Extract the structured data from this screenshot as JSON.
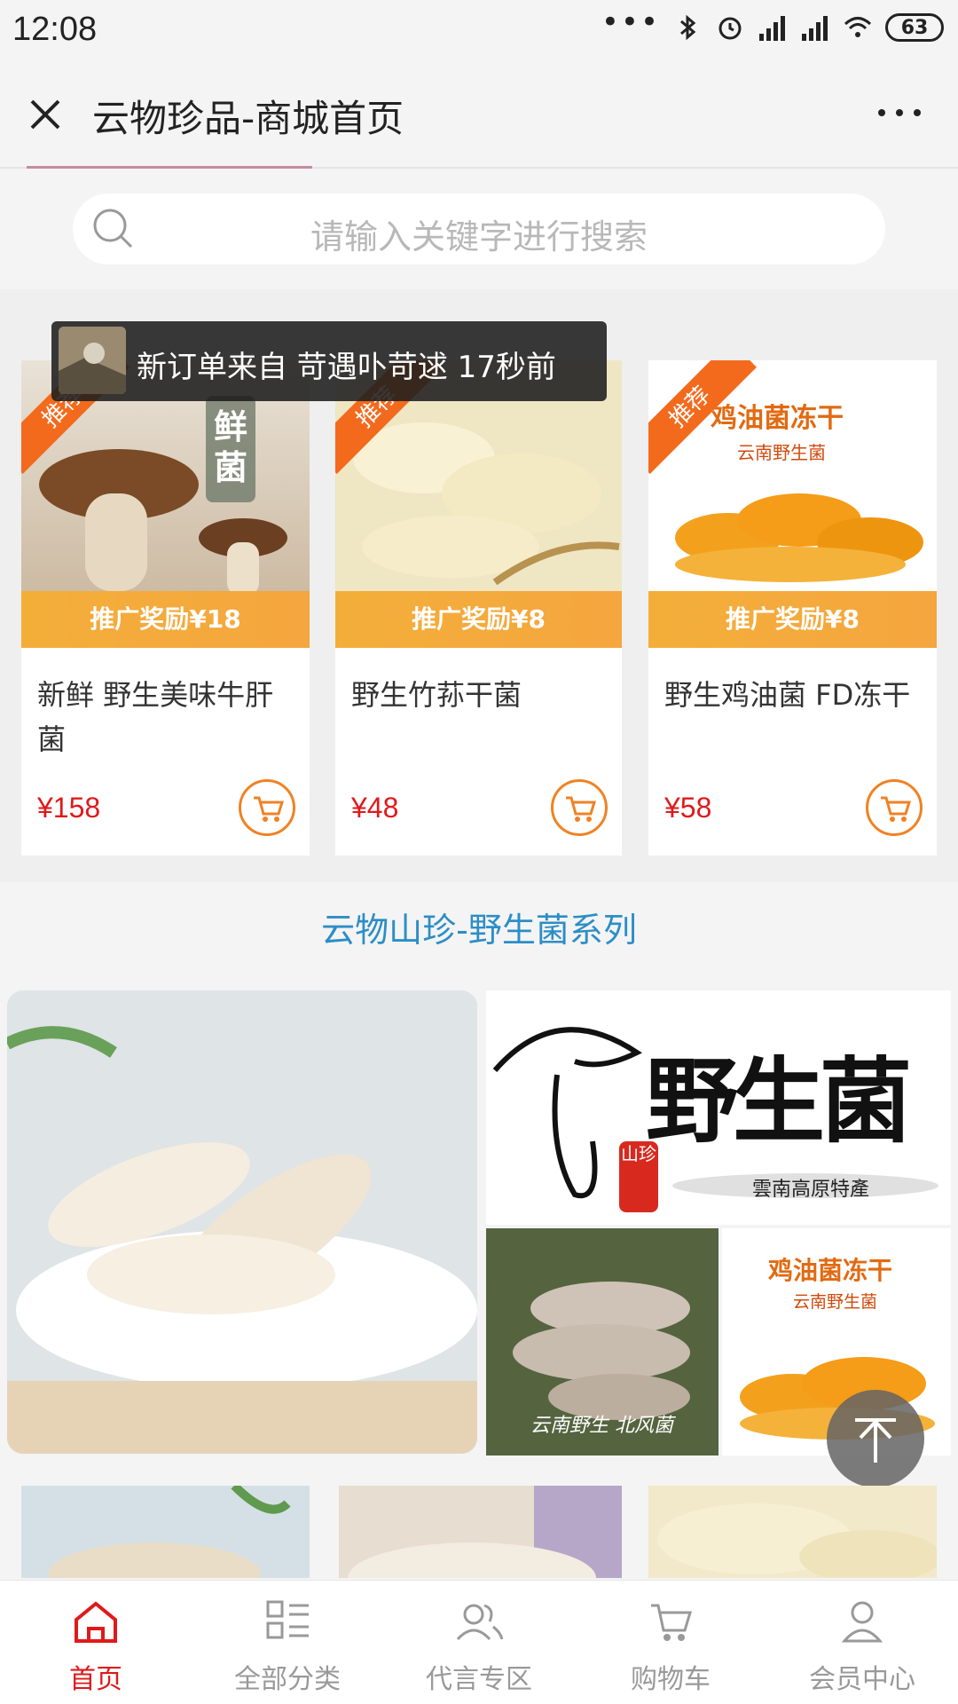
{
  "status_bar": {
    "time": "12:08",
    "battery": "63"
  },
  "titlebar": {
    "title": "云物珍品-商城首页"
  },
  "search": {
    "placeholder": "请输入关键字进行搜索"
  },
  "toast": {
    "text": "新订单来自 苛遇卟苛逑 17秒前"
  },
  "products": [
    {
      "ribbon": "推荐",
      "reward": "推广奖励¥18",
      "name": "新鲜 野生美味牛肝菌",
      "price": "¥158",
      "img_text": "鲜菌"
    },
    {
      "ribbon": "推荐",
      "reward": "推广奖励¥8",
      "name": "野生竹荪干菌",
      "price": "¥48"
    },
    {
      "ribbon": "推荐",
      "reward": "推广奖励¥8",
      "name": "野生鸡油菌 FD冻干",
      "price": "¥58",
      "img_title": "鸡油菌冻干",
      "img_sub": "云南野生菌"
    }
  ],
  "section": {
    "title": "云物山珍-野生菌系列",
    "logo_text": "野生菌",
    "logo_seal": "山珍",
    "logo_sub": "雲南高原特產",
    "sm1_text": "云南野生 北风菌",
    "sm2_title": "鸡油菌冻干",
    "sm2_sub": "云南野生菌"
  },
  "bottom_nav": [
    {
      "label": "首页",
      "icon": "home-icon",
      "active": true
    },
    {
      "label": "全部分类",
      "icon": "category-icon",
      "active": false
    },
    {
      "label": "代言专区",
      "icon": "users-icon",
      "active": false
    },
    {
      "label": "购物车",
      "icon": "cart-icon",
      "active": false
    },
    {
      "label": "会员中心",
      "icon": "user-icon",
      "active": false
    }
  ],
  "colors": {
    "accent": "#e0191a",
    "orange": "#f36a1d",
    "reward": "#f3ae3a",
    "section_title": "#2c8ec6"
  }
}
